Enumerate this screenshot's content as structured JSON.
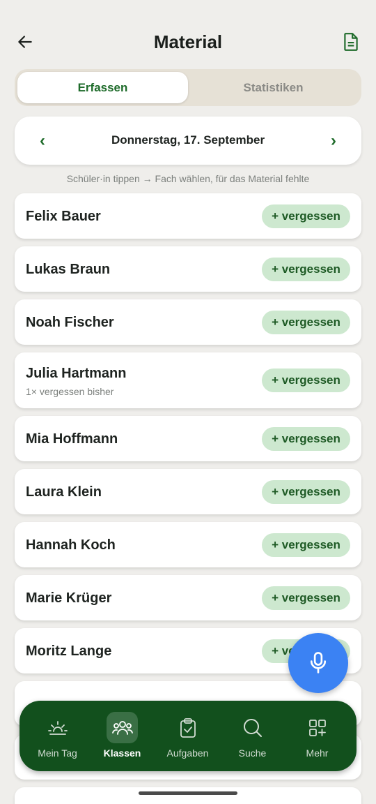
{
  "header": {
    "title": "Material"
  },
  "tabs": [
    {
      "label": "Erfassen",
      "active": true
    },
    {
      "label": "Statistiken",
      "active": false
    }
  ],
  "date": {
    "label": "Donnerstag, 17. September",
    "prev": "‹",
    "next": "›"
  },
  "hint": "Schüler·in tippen → Fach wählen, für das Material fehlte",
  "students": [
    {
      "name": "Felix Bauer",
      "sub": "",
      "action": "+ vergessen"
    },
    {
      "name": "Lukas Braun",
      "sub": "",
      "action": "+ vergessen"
    },
    {
      "name": "Noah Fischer",
      "sub": "",
      "action": "+ vergessen"
    },
    {
      "name": "Julia Hartmann",
      "sub": "1× vergessen bisher",
      "action": "+ vergessen"
    },
    {
      "name": "Mia Hoffmann",
      "sub": "",
      "action": "+ vergessen"
    },
    {
      "name": "Laura Klein",
      "sub": "",
      "action": "+ vergessen"
    },
    {
      "name": "Hannah Koch",
      "sub": "",
      "action": "+ vergessen"
    },
    {
      "name": "Marie Krüger",
      "sub": "",
      "action": "+ vergessen"
    },
    {
      "name": "Moritz Lange",
      "sub": "",
      "action": "+ vergessen"
    }
  ],
  "nav": [
    {
      "label": "Mein Tag",
      "icon": "sunrise-icon",
      "active": false
    },
    {
      "label": "Klassen",
      "icon": "people-icon",
      "active": true
    },
    {
      "label": "Aufgaben",
      "icon": "clipboard-check-icon",
      "active": false
    },
    {
      "label": "Suche",
      "icon": "search-icon",
      "active": false
    },
    {
      "label": "Mehr",
      "icon": "grid-plus-icon",
      "active": false
    }
  ],
  "colors": {
    "accent": "#1e6b2a",
    "chip": "#cde8cf",
    "nav_bg": "#12501d",
    "fab": "#3b82f3"
  }
}
